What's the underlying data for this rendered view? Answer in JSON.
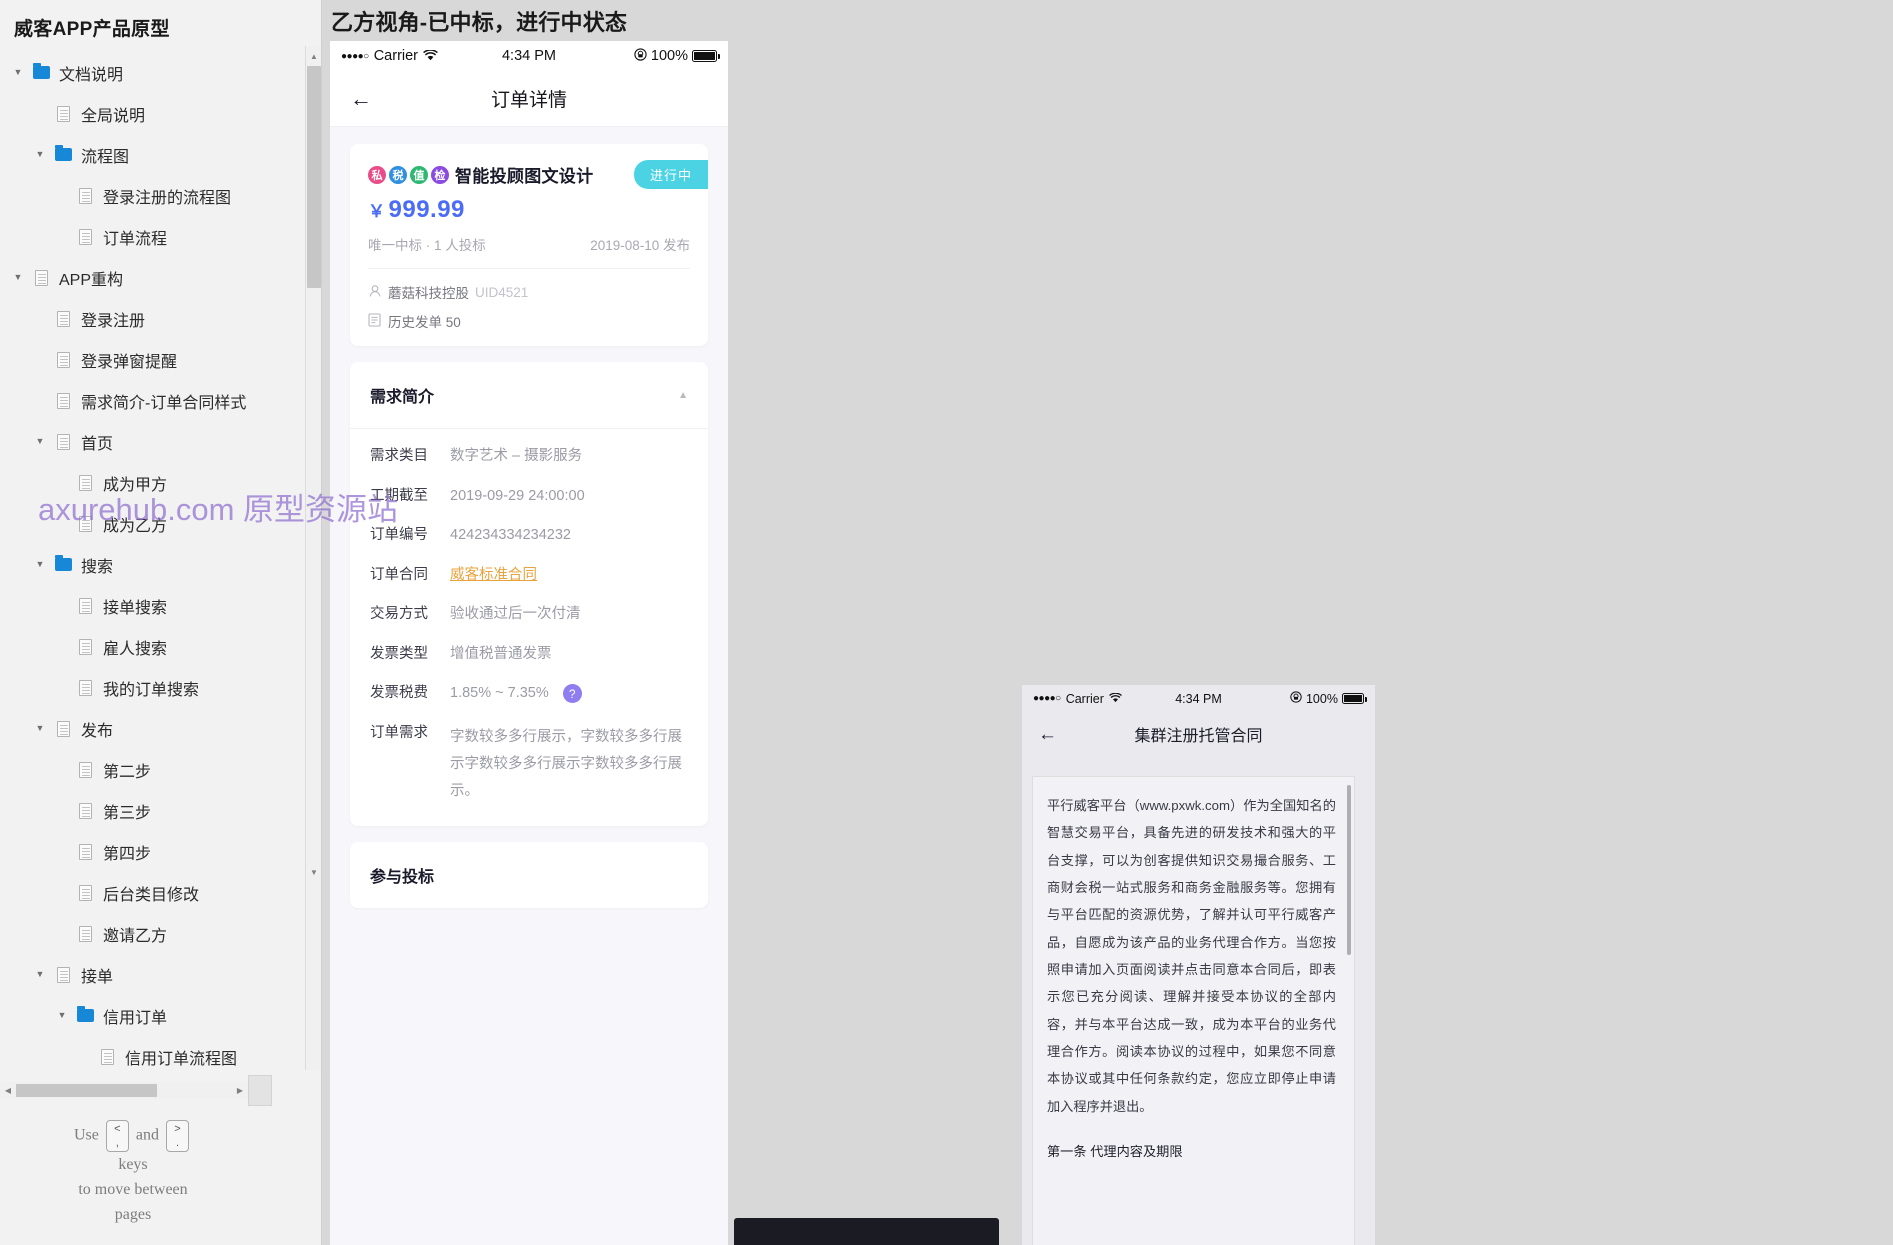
{
  "sitemap": {
    "title": "威客APP产品原型",
    "nodes": [
      {
        "depth": 1,
        "twisty": "▼",
        "icon": "folder",
        "label": "文档说明"
      },
      {
        "depth": 2,
        "twisty": "",
        "icon": "page",
        "label": "全局说明"
      },
      {
        "depth": 2,
        "twisty": "▼",
        "icon": "folder",
        "label": "流程图"
      },
      {
        "depth": 3,
        "twisty": "",
        "icon": "page",
        "label": "登录注册的流程图"
      },
      {
        "depth": 3,
        "twisty": "",
        "icon": "page",
        "label": "订单流程"
      },
      {
        "depth": 1,
        "twisty": "▼",
        "icon": "page",
        "label": "APP重构"
      },
      {
        "depth": 2,
        "twisty": "",
        "icon": "page",
        "label": "登录注册"
      },
      {
        "depth": 2,
        "twisty": "",
        "icon": "page",
        "label": "登录弹窗提醒"
      },
      {
        "depth": 2,
        "twisty": "",
        "icon": "page",
        "label": "需求简介-订单合同样式"
      },
      {
        "depth": 2,
        "twisty": "▼",
        "icon": "page",
        "label": "首页"
      },
      {
        "depth": 3,
        "twisty": "",
        "icon": "page",
        "label": "成为甲方"
      },
      {
        "depth": 3,
        "twisty": "",
        "icon": "page",
        "label": "成为乙方"
      },
      {
        "depth": 2,
        "twisty": "▼",
        "icon": "folder",
        "label": "搜索"
      },
      {
        "depth": 3,
        "twisty": "",
        "icon": "page",
        "label": "接单搜索"
      },
      {
        "depth": 3,
        "twisty": "",
        "icon": "page",
        "label": "雇人搜索"
      },
      {
        "depth": 3,
        "twisty": "",
        "icon": "page",
        "label": "我的订单搜索"
      },
      {
        "depth": 2,
        "twisty": "▼",
        "icon": "page",
        "label": "发布"
      },
      {
        "depth": 3,
        "twisty": "",
        "icon": "page",
        "label": "第二步"
      },
      {
        "depth": 3,
        "twisty": "",
        "icon": "page",
        "label": "第三步"
      },
      {
        "depth": 3,
        "twisty": "",
        "icon": "page",
        "label": "第四步"
      },
      {
        "depth": 3,
        "twisty": "",
        "icon": "page",
        "label": "后台类目修改"
      },
      {
        "depth": 3,
        "twisty": "",
        "icon": "page",
        "label": "邀请乙方"
      },
      {
        "depth": 2,
        "twisty": "▼",
        "icon": "page",
        "label": "接单"
      },
      {
        "depth": 3,
        "twisty": "▼",
        "icon": "folder",
        "label": "信用订单"
      },
      {
        "depth": 4,
        "twisty": "",
        "icon": "page",
        "label": "信用订单流程图"
      }
    ],
    "hint": {
      "use": "Use",
      "and": "and",
      "prev_key_top": "<",
      "prev_key_bottom": ",",
      "next_key_top": ">",
      "next_key_bottom": ".",
      "line2": "keys",
      "line3": "to move between",
      "line4": "pages"
    }
  },
  "canvas": {
    "page_heading": "乙方视角-已中标，进行中状态"
  },
  "phone1": {
    "statusbar": {
      "carrier": "Carrier",
      "signal_dots": "●●●●○",
      "wifi_icon": "wifi-icon",
      "time": "4:34 PM",
      "battery_percent": "100%",
      "lock_icon": "rotation-lock-icon"
    },
    "navbar": {
      "back_icon": "back-arrow-icon",
      "title": "订单详情"
    },
    "order_card": {
      "badges": [
        {
          "text": "私",
          "color": "#ea4c89"
        },
        {
          "text": "税",
          "color": "#2f8fe0"
        },
        {
          "text": "值",
          "color": "#2eb872"
        },
        {
          "text": "检",
          "color": "#8a4be0"
        }
      ],
      "title": "智能投顾图文设计",
      "status": "进行中",
      "status_color": "#4cd3e3",
      "currency": "￥",
      "price": "999.99",
      "bid_info": "唯一中标 · 1 人投标",
      "publish_date": "2019-08-10 发布",
      "company": "蘑菇科技控股",
      "uid": "UID4521",
      "history_orders": "历史发单 50"
    },
    "requirements_section": {
      "title": "需求简介",
      "collapse_icon": "caret-up-icon",
      "rows": [
        {
          "key": "需求类目",
          "value": "数字艺术 – 摄影服务",
          "style": "normal"
        },
        {
          "key": "工期截至",
          "value": "2019-09-29 24:00:00",
          "style": "normal"
        },
        {
          "key": "订单编号",
          "value": "424234334234232",
          "style": "normal"
        },
        {
          "key": "订单合同",
          "value": "威客标准合同",
          "style": "link"
        },
        {
          "key": "交易方式",
          "value": "验收通过后一次付清",
          "style": "normal"
        },
        {
          "key": "发票类型",
          "value": "增值税普通发票",
          "style": "normal"
        },
        {
          "key": "发票税费",
          "value": "1.85% ~ 7.35%",
          "style": "with-help"
        },
        {
          "key": "订单需求",
          "value": "字数较多多行展示，字数较多多行展示字数较多多行展示字数较多多行展示。",
          "style": "multi"
        }
      ],
      "help_icon": "question-mark-icon"
    },
    "bids_section": {
      "title": "参与投标"
    }
  },
  "phone2": {
    "statusbar": {
      "carrier": "Carrier",
      "signal_dots": "●●●●○",
      "wifi_icon": "wifi-icon",
      "time": "4:34 PM",
      "battery_percent": "100%",
      "lock_icon": "rotation-lock-icon"
    },
    "navbar": {
      "back_icon": "back-arrow-icon",
      "title": "集群注册托管合同"
    },
    "contract": {
      "paragraph": "平行威客平台（www.pxwk.com）作为全国知名的智慧交易平台，具备先进的研发技术和强大的平台支撑，可以为创客提供知识交易撮合服务、工商财会税一站式服务和商务金融服务等。您拥有与平台匹配的资源优势，了解并认可平行威客产品，自愿成为该产品的业务代理合作方。当您按照申请加入页面阅读并点击同意本合同后，即表示您已充分阅读、理解并接受本协议的全部内容，并与本平台达成一致，成为本平台的业务代理合作方。阅读本协议的过程中，如果您不同意本协议或其中任何条款约定，您应立即停止申请加入程序并退出。",
      "heading": "第一条 代理内容及期限"
    }
  },
  "watermark": "axurehub.com 原型资源站"
}
